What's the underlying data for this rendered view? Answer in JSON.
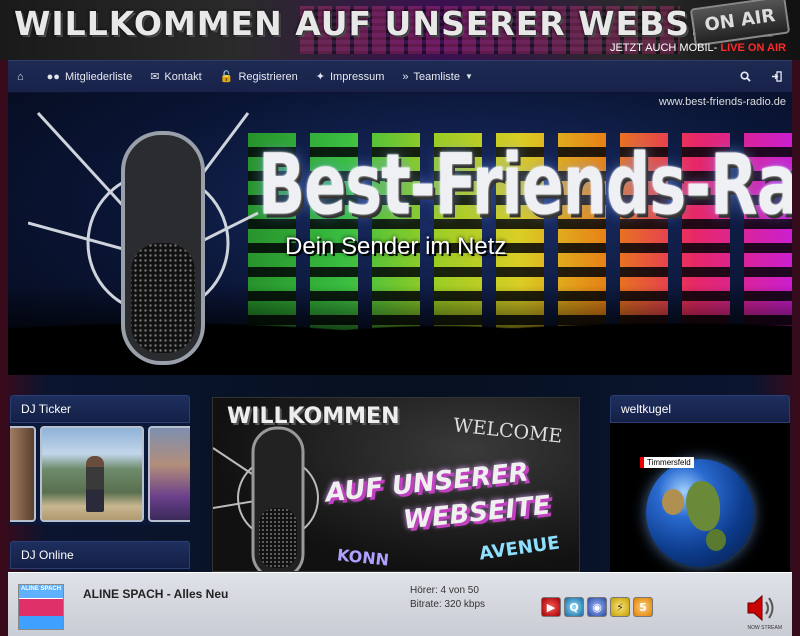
{
  "header": {
    "title": "WILLKOMMEN AUF UNSERER WEBSEITE",
    "badge": "ON AIR",
    "tagline_prefix": "JETZT AUCH MOBIL-",
    "tagline_live": "LIVE ON AIR"
  },
  "nav": {
    "items": [
      {
        "label": "",
        "icon": "home-icon"
      },
      {
        "label": "Mitgliederliste",
        "icon": "users-icon"
      },
      {
        "label": "Kontakt",
        "icon": "envelope-icon"
      },
      {
        "label": "Registrieren",
        "icon": "unlock-icon"
      },
      {
        "label": "Impressum",
        "icon": "wrench-icon"
      },
      {
        "label": "Teamliste",
        "icon": "double-chevron-right-icon"
      }
    ],
    "right": [
      {
        "icon": "search-icon"
      },
      {
        "icon": "sign-in-icon"
      }
    ]
  },
  "banner": {
    "url": "www.best-friends-radio.de",
    "title": "Best-Friends-Radio",
    "subtitle": "Dein Sender im Netz"
  },
  "sidebar_left": {
    "ticker_title": "DJ Ticker",
    "online_title": "DJ Online"
  },
  "welcome": {
    "title": "WILLKOMMEN",
    "english": "WELCOME",
    "line1": "AUF UNSERER",
    "line2": "WEBSEITE",
    "bottom_left": "KONN",
    "bottom_right": "AVENUE"
  },
  "sidebar_right": {
    "title": "weltkugel",
    "marker": "Timmersfeld"
  },
  "player": {
    "cover_label": "ALINE SPACH",
    "track": "ALINE SPACH - Alles Neu",
    "listeners": "Hörer: 4 von 50",
    "bitrate": "Bitrate: 320 kbps",
    "volume_label": "NOW STREAM"
  },
  "colors": {
    "navbar": "#1e2a52",
    "live": "#ff2a2a",
    "panel_header": "#1e2f5e"
  }
}
